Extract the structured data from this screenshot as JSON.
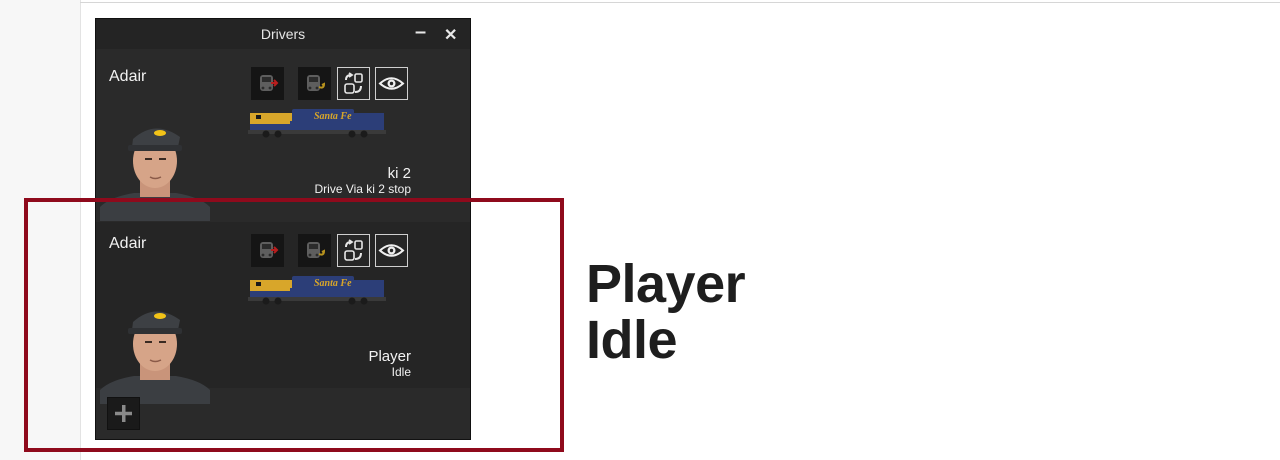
{
  "window": {
    "title": "Drivers",
    "minimize_glyph": "–",
    "close_glyph": "✕"
  },
  "drivers": [
    {
      "name": "Adair",
      "status_primary": "ki 2",
      "status_secondary": "Drive Via ki 2 stop",
      "loco_livery_text": "Santa Fe"
    },
    {
      "name": "Adair",
      "status_primary": "Player",
      "status_secondary": "Idle",
      "loco_livery_text": "Santa Fe"
    }
  ],
  "action_icons": [
    "train-remove-icon",
    "train-couple-icon",
    "swap-control-icon",
    "eye-icon"
  ],
  "add_driver_icon": "plus-icon",
  "callout": {
    "line1": "Player",
    "line2": "Idle"
  },
  "colors": {
    "window_bg": "#2a2a2a",
    "highlight_frame": "#8f0a1c",
    "loco_yellow": "#d8a62a",
    "loco_blue": "#2c3e78",
    "loco_red": "#c0392b"
  }
}
